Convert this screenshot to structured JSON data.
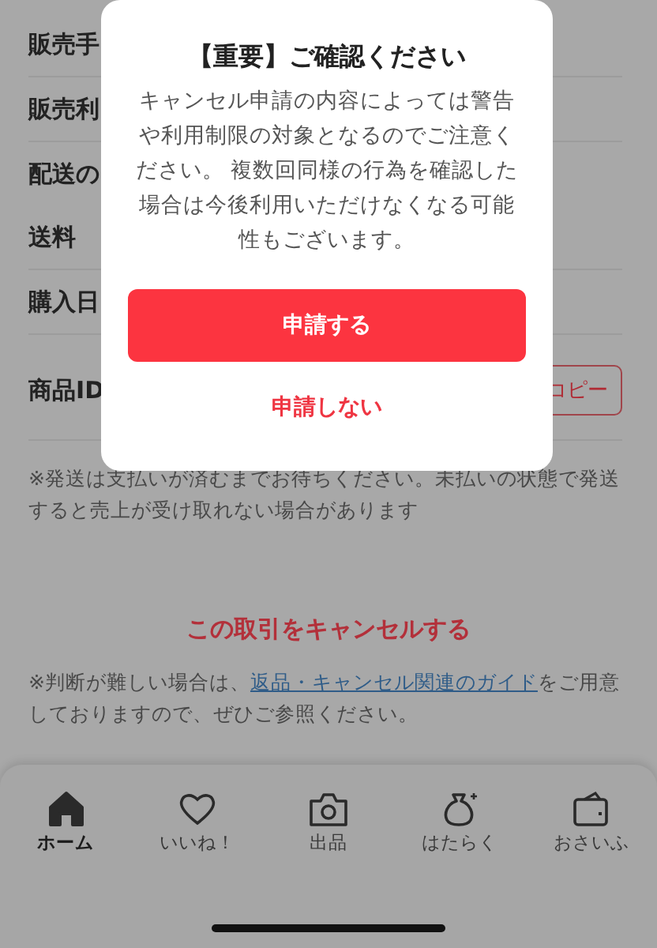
{
  "rows": [
    {
      "label": "販売手"
    },
    {
      "label": "販売利"
    },
    {
      "label": "配送の"
    },
    {
      "label": "送料"
    },
    {
      "label": "購入日"
    },
    {
      "label": "商品ID",
      "action": "コピー"
    }
  ],
  "shipping_note": "※発送は支払いが済むまでお待ちください。未払いの状態で発送すると売上が受け取れない場合があります",
  "cancel_link": "この取引をキャンセルする",
  "guide_note": {
    "before": "※判断が難しい場合は、",
    "link": "返品・キャンセル関連のガイド",
    "after": "をご用意しておりますので、ぜひご参照ください。"
  },
  "dialog": {
    "title": "【重要】ご確認ください",
    "message": "キャンセル申請の内容によっては警告や利用制限の対象となるのでご注意ください。 複数回同様の行為を確認した場合は今後利用いただけなくなる可能性もございます。",
    "primary": "申請する",
    "secondary": "申請しない"
  },
  "tabs": [
    {
      "label": "ホーム",
      "kind": "home",
      "selected": true
    },
    {
      "label": "いいね！",
      "kind": "heart",
      "selected": false
    },
    {
      "label": "出品",
      "kind": "camera",
      "selected": false
    },
    {
      "label": "はたらく",
      "kind": "bag",
      "selected": false
    },
    {
      "label": "おさいふ",
      "kind": "wallet",
      "selected": false
    }
  ]
}
